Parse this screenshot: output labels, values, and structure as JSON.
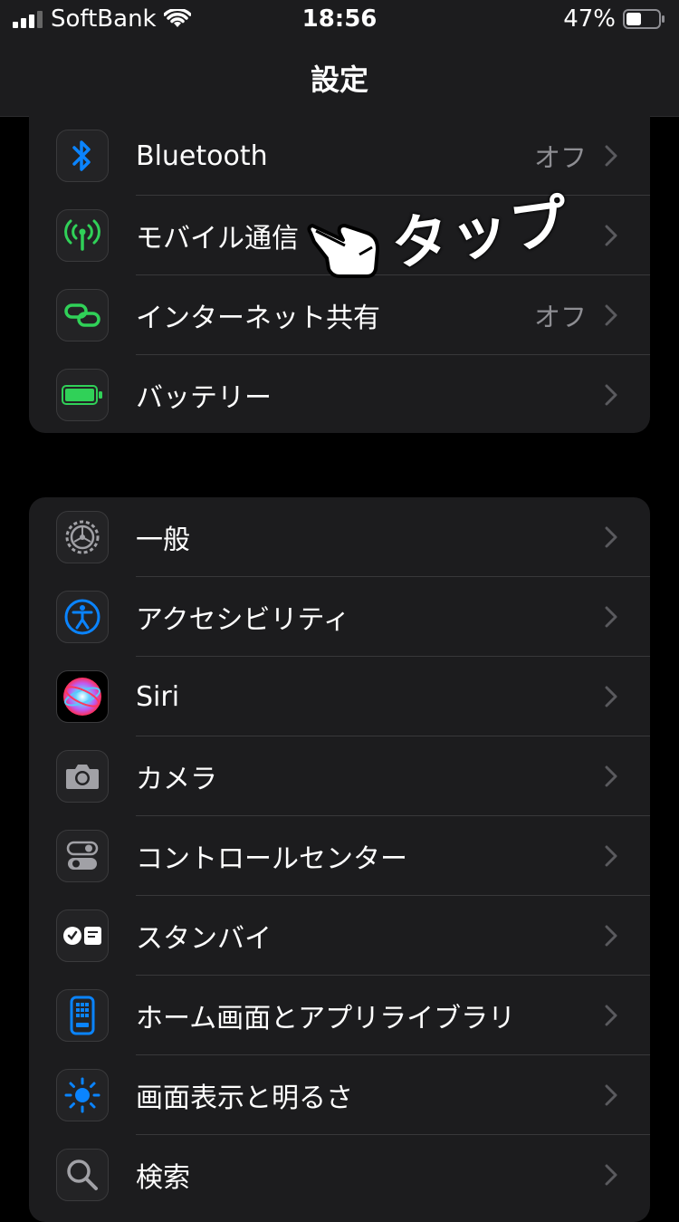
{
  "status_bar": {
    "carrier": "SoftBank",
    "time": "18:56",
    "battery_percent": "47%",
    "battery_level": 0.47
  },
  "nav": {
    "title": "設定"
  },
  "annotation": {
    "tap_label": "タップ"
  },
  "group1": [
    {
      "label": "Bluetooth",
      "value": "オフ",
      "icon": "bluetooth-icon",
      "color": "#0a84ff"
    },
    {
      "label": "モバイル通信",
      "value": "",
      "icon": "antenna-icon",
      "color": "#30d158"
    },
    {
      "label": "インターネット共有",
      "value": "オフ",
      "icon": "link-icon",
      "color": "#30d158"
    },
    {
      "label": "バッテリー",
      "value": "",
      "icon": "battery-icon",
      "color": "#30d158"
    }
  ],
  "group2": [
    {
      "label": "一般",
      "icon": "gear-icon",
      "color": "#8e8e93"
    },
    {
      "label": "アクセシビリティ",
      "icon": "accessibility-icon",
      "color": "#0a84ff"
    },
    {
      "label": "Siri",
      "icon": "siri-icon",
      "color": "#ff375f"
    },
    {
      "label": "カメラ",
      "icon": "camera-icon",
      "color": "#8e8e93"
    },
    {
      "label": "コントロールセンター",
      "icon": "switches-icon",
      "color": "#8e8e93"
    },
    {
      "label": "スタンバイ",
      "icon": "standby-icon",
      "color": "#ffffff"
    },
    {
      "label": "ホーム画面とアプリライブラリ",
      "icon": "home-screen-icon",
      "color": "#0a84ff"
    },
    {
      "label": "画面表示と明るさ",
      "icon": "brightness-icon",
      "color": "#0a84ff"
    },
    {
      "label": "検索",
      "icon": "magnifier-icon",
      "color": "#8e8e93"
    }
  ]
}
